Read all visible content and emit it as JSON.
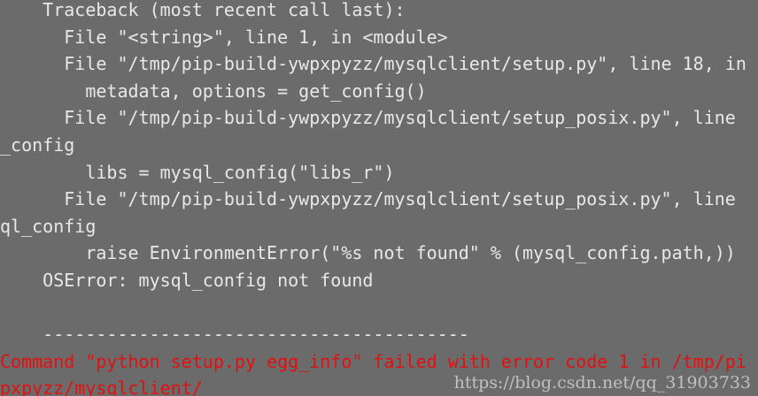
{
  "terminal": {
    "lines": [
      "    Traceback (most recent call last):",
      "      File \"<string>\", line 1, in <module>",
      "      File \"/tmp/pip-build-ywpxpyzz/mysqlclient/setup.py\", line 18, in",
      "        metadata, options = get_config()",
      "      File \"/tmp/pip-build-ywpxpyzz/mysqlclient/setup_posix.py\", line",
      "_config",
      "        libs = mysql_config(\"libs_r\")",
      "      File \"/tmp/pip-build-ywpxpyzz/mysqlclient/setup_posix.py\", line",
      "ql_config",
      "        raise EnvironmentError(\"%s not found\" % (mysql_config.path,))",
      "    OSError: mysql_config not found",
      "",
      "    ----------------------------------------",
      "Command \"python setup.py egg_info\" failed with error code 1 in /tmp/pi",
      "pxpyzz/mysqlclient/"
    ],
    "error_color": "#e31010",
    "text_color": "#e8e8e8",
    "background_color": "#6b6b6b"
  },
  "watermark": "https://blog.csdn.net/qq_31903733"
}
